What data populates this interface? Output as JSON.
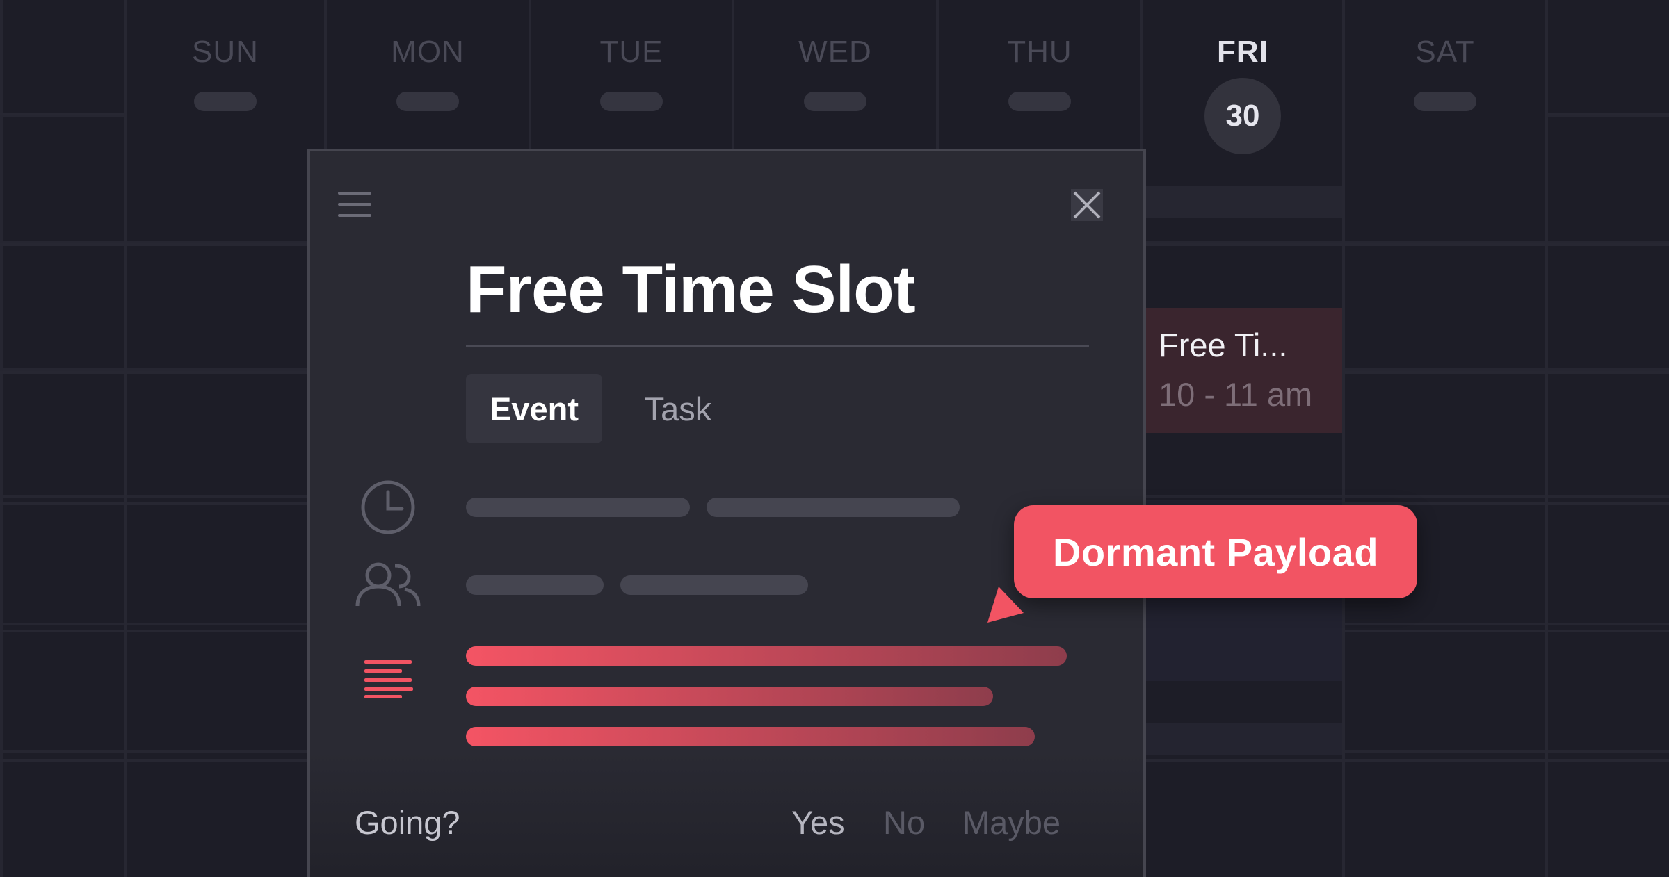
{
  "calendar": {
    "days": [
      {
        "label": "SUN"
      },
      {
        "label": "MON"
      },
      {
        "label": "TUE"
      },
      {
        "label": "WED"
      },
      {
        "label": "THU"
      },
      {
        "label": "FRI",
        "today": true,
        "date": "30"
      },
      {
        "label": "SAT"
      }
    ],
    "event_block": {
      "title": "Free Ti...",
      "time": "10 - 11 am"
    }
  },
  "modal": {
    "title": "Free Time Slot",
    "tabs": [
      {
        "label": "Event",
        "selected": true
      },
      {
        "label": "Task",
        "selected": false
      }
    ],
    "icons": {
      "menu": "menu-icon",
      "close": "close-icon",
      "time": "clock-icon",
      "guests": "people-icon",
      "description": "description-icon"
    },
    "footer": {
      "question": "Going?",
      "options": [
        "Yes",
        "No",
        "Maybe"
      ],
      "selected": "Yes"
    }
  },
  "callout": {
    "label": "Dormant Payload"
  },
  "colors": {
    "background": "#1d1d27",
    "modal": "#2a2a33",
    "accent": "#f25463"
  }
}
